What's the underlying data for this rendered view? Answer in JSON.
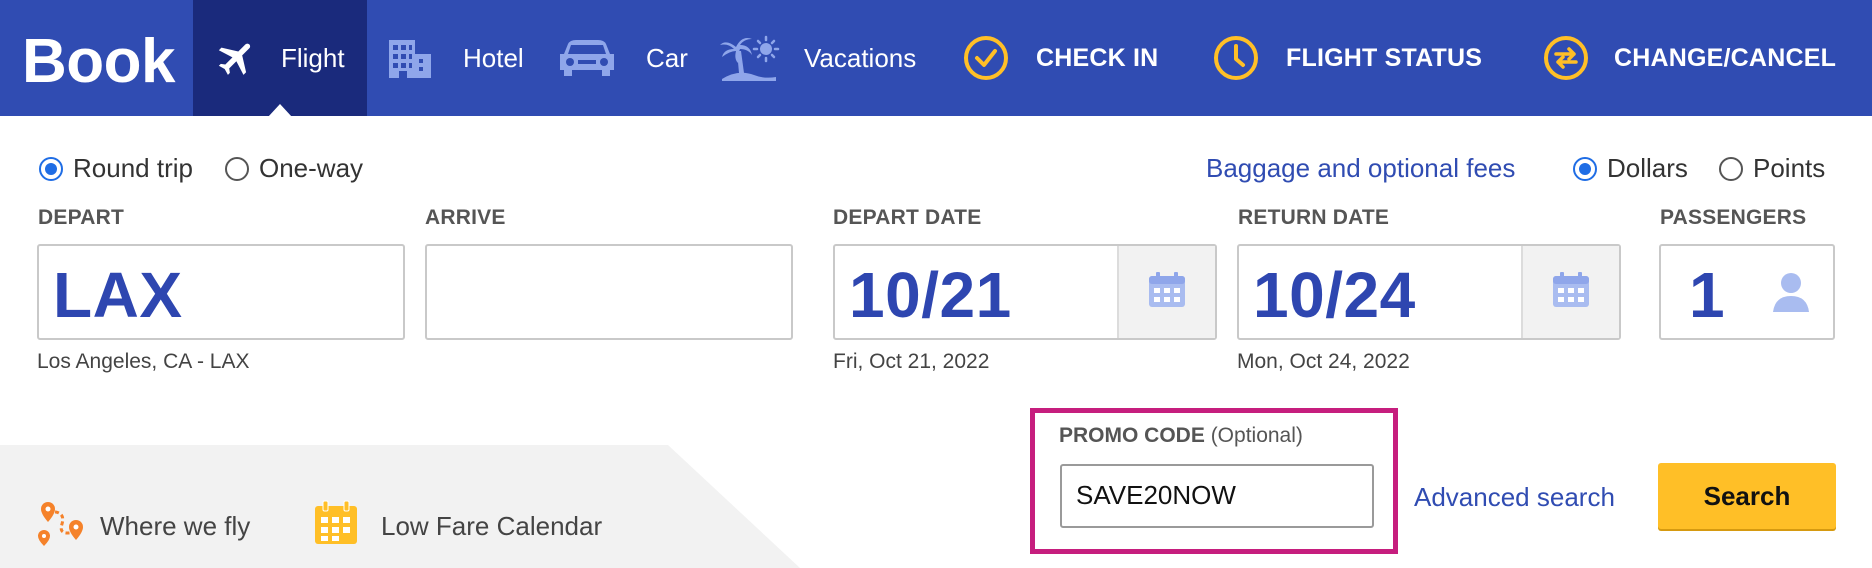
{
  "header": {
    "book_label": "Book",
    "tabs": [
      {
        "label": "Flight",
        "icon": "airplane-icon"
      },
      {
        "label": "Hotel",
        "icon": "hotel-icon"
      },
      {
        "label": "Car",
        "icon": "car-icon"
      },
      {
        "label": "Vacations",
        "icon": "palm-tree-icon"
      }
    ],
    "actions": [
      {
        "label": "CHECK IN",
        "icon": "check-circle-icon"
      },
      {
        "label": "FLIGHT STATUS",
        "icon": "clock-icon"
      },
      {
        "label": "CHANGE/CANCEL",
        "icon": "swap-arrows-icon"
      }
    ]
  },
  "trip_type": {
    "round_trip": "Round trip",
    "one_way": "One-way",
    "selected": "Round trip"
  },
  "baggage_link": "Baggage and optional fees",
  "currency": {
    "dollars": "Dollars",
    "points": "Points",
    "selected": "Dollars"
  },
  "depart": {
    "label": "DEPART",
    "value": "LAX",
    "sub": "Los Angeles, CA - LAX"
  },
  "arrive": {
    "label": "ARRIVE",
    "value": ""
  },
  "depart_date": {
    "label": "DEPART DATE",
    "value": "10/21",
    "sub": "Fri, Oct 21, 2022"
  },
  "return_date": {
    "label": "RETURN DATE",
    "value": "10/24",
    "sub": "Mon, Oct 24, 2022"
  },
  "passengers": {
    "label": "PASSENGERS",
    "value": "1"
  },
  "footer_links": {
    "where_we_fly": "Where we fly",
    "low_fare_calendar": "Low Fare Calendar"
  },
  "promo": {
    "label": "PROMO CODE",
    "optional": "(Optional)",
    "value": "SAVE20NOW"
  },
  "advanced_search": "Advanced search",
  "search_button": "Search",
  "colors": {
    "nav_bg": "#304cb2",
    "nav_active": "#1a2a7c",
    "accent_yellow": "#ffbf27",
    "highlight": "#c61e7e"
  }
}
